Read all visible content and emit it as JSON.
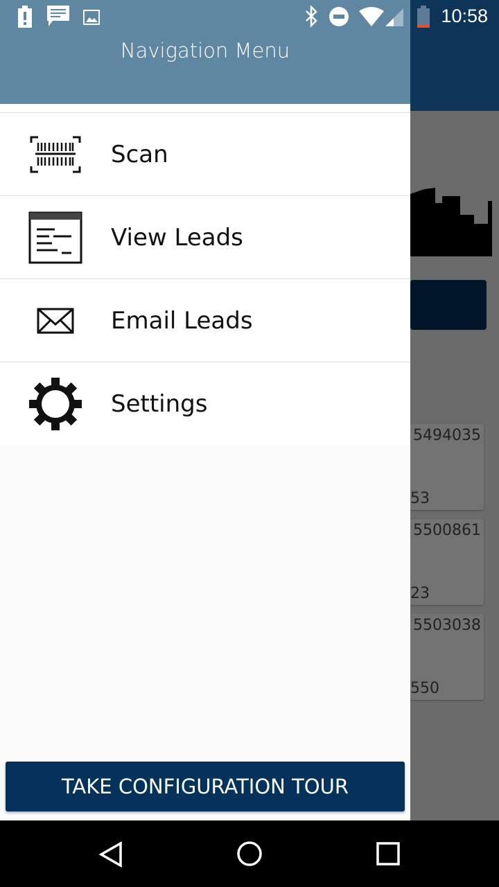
{
  "status_bar": {
    "time": "10:58",
    "icons": [
      "battery-alert-icon",
      "message-icon",
      "image-icon",
      "bluetooth-icon",
      "do-not-disturb-icon",
      "wifi-icon",
      "signal-icon",
      "battery-icon"
    ]
  },
  "drawer": {
    "title": "Navigation Menu",
    "items": [
      {
        "label": "Scan",
        "icon": "barcode-scan-icon"
      },
      {
        "label": "View Leads",
        "icon": "list-window-icon"
      },
      {
        "label": "Email Leads",
        "icon": "envelope-icon"
      },
      {
        "label": "Settings",
        "icon": "gear-icon"
      }
    ],
    "tour_button": "TAKE CONFIGURATION TOUR"
  },
  "background": {
    "cards": [
      {
        "number": "5494035",
        "sub": "53"
      },
      {
        "number": "5500861",
        "sub": "23"
      },
      {
        "number": "5503038",
        "sub": "550"
      }
    ]
  },
  "nav_bar": [
    "back-icon",
    "home-icon",
    "recents-icon"
  ]
}
